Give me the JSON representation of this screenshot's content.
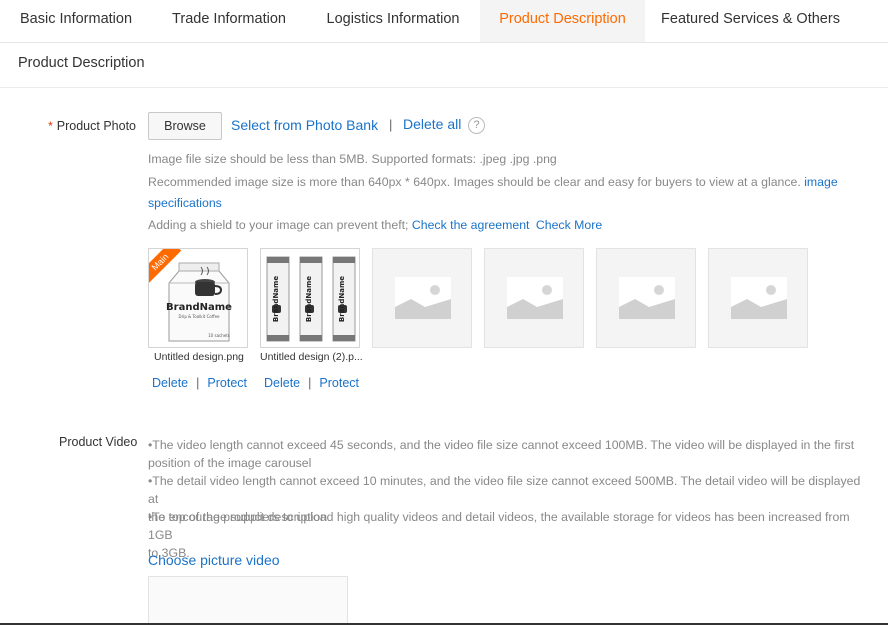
{
  "tabs": [
    {
      "label": "Basic Information"
    },
    {
      "label": "Trade Information"
    },
    {
      "label": "Logistics Information"
    },
    {
      "label": "Product Description"
    },
    {
      "label": "Featured Services & Others"
    }
  ],
  "section": {
    "title": "Product Description"
  },
  "photo": {
    "label": "Product Photo",
    "required_mark": "*",
    "browse": "Browse",
    "select_bank": "Select from Photo Bank",
    "separator": "|",
    "delete_all": "Delete all",
    "help": "?",
    "hint_size": "Image file size should be less than 5MB. Supported formats: .jpeg .jpg .png",
    "hint_recommend": "Recommended image size is more than 640px * 640px. Images should be clear and easy for buyers to view at a glance.",
    "hint_spec_link_1": "image",
    "hint_spec_link_2": "specifications",
    "hint_shield": "Adding a shield to your image can prevent theft;",
    "agreement_link": "Check the agreement",
    "check_more": "Check More",
    "main_badge": "Main",
    "files": [
      {
        "name": "Untitled design.png",
        "delete": "Delete",
        "protect": "Protect",
        "brand": "BrandName",
        "count": "10 sachets"
      },
      {
        "name": "Untitled design (2).p...",
        "delete": "Delete",
        "protect": "Protect",
        "brand": "BrandName"
      }
    ]
  },
  "video": {
    "label": "Product Video",
    "bullet1_a": "•The video length cannot exceed 45 seconds, and the video file size cannot exceed 100MB. The video will be displayed in the first",
    "bullet1_b": "position of the image carousel",
    "bullet2_a": "•The detail video length cannot exceed 10 minutes, and the video file size cannot exceed 500MB. The detail video will be displayed at",
    "bullet2_b": "the top of the product description",
    "bullet3_a": "•To encourage suppliers to upload high quality videos and detail videos, the available storage for videos has been increased from 1GB",
    "bullet3_b": "to 3GB.",
    "choose": "Choose picture video"
  },
  "colors": {
    "accent": "#ff6a00",
    "link": "#1a73c9",
    "hint": "#888888"
  }
}
